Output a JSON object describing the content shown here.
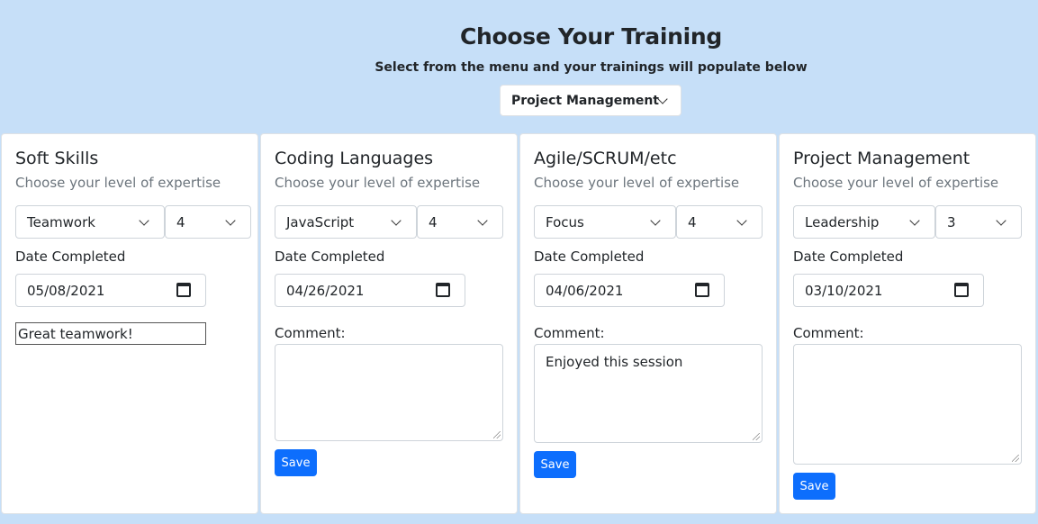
{
  "header": {
    "title": "Choose Your Training",
    "subtitle": "Select from the menu and your trainings will populate below",
    "selected_training": "Project Management"
  },
  "common": {
    "expertise_prompt": "Choose your level of expertise",
    "date_label": "Date Completed",
    "comment_label": "Comment:",
    "save_label": "Save"
  },
  "cards": [
    {
      "title": "Soft Skills",
      "skill": "Teamwork",
      "level": "4",
      "date": "05/08/2021",
      "comment": "Great teamwork!"
    },
    {
      "title": "Coding Languages",
      "skill": "JavaScript",
      "level": "4",
      "date": "04/26/2021",
      "comment": ""
    },
    {
      "title": "Agile/SCRUM/etc",
      "skill": "Focus",
      "level": "4",
      "date": "04/06/2021",
      "comment": "Enjoyed this session"
    },
    {
      "title": "Project Management",
      "skill": "Leadership",
      "level": "3",
      "date": "03/10/2021",
      "comment": ""
    }
  ],
  "colors": {
    "background": "#c6dff8",
    "accent": "#0d6efd"
  }
}
